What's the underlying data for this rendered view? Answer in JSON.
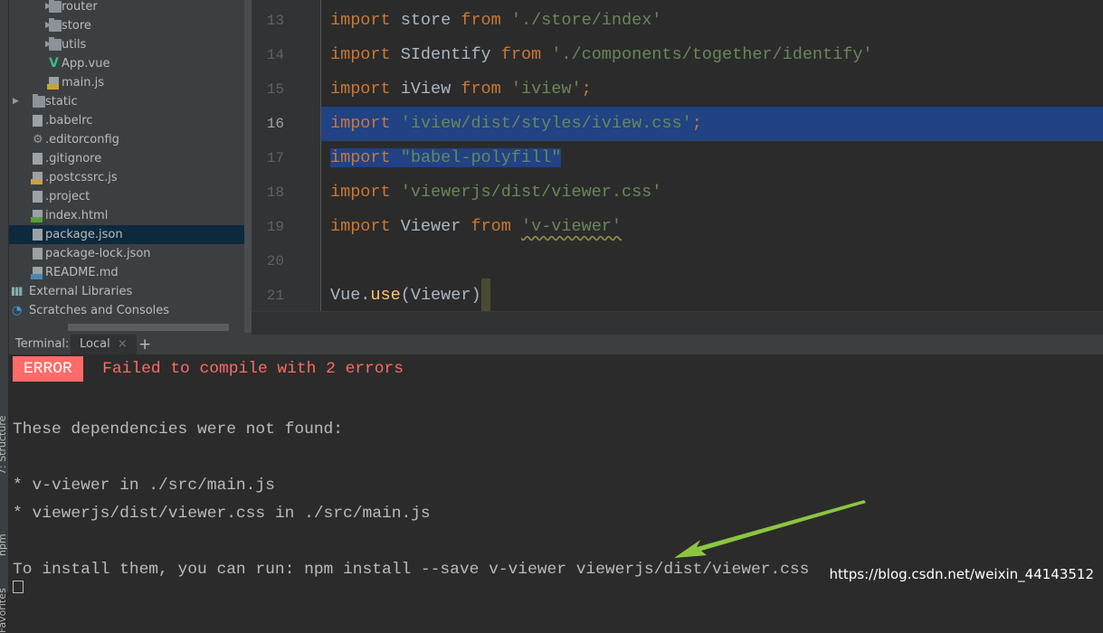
{
  "side_labels": [
    "7: Structure",
    "npm",
    "Favorites"
  ],
  "tree": [
    {
      "label": "router",
      "type": "folder",
      "depth": 2,
      "expandable": true
    },
    {
      "label": "store",
      "type": "folder",
      "depth": 2,
      "expandable": true
    },
    {
      "label": "utils",
      "type": "folder",
      "depth": 2,
      "expandable": true
    },
    {
      "label": "App.vue",
      "type": "vue",
      "depth": 2
    },
    {
      "label": "main.js",
      "type": "js",
      "depth": 2
    },
    {
      "label": "static",
      "type": "folder",
      "depth": 1,
      "expandable": true
    },
    {
      "label": ".babelrc",
      "type": "json",
      "depth": 1
    },
    {
      "label": ".editorconfig",
      "type": "gear",
      "depth": 1
    },
    {
      "label": ".gitignore",
      "type": "text",
      "depth": 1
    },
    {
      "label": ".postcssrc.js",
      "type": "js",
      "depth": 1
    },
    {
      "label": ".project",
      "type": "text",
      "depth": 1
    },
    {
      "label": "index.html",
      "type": "html",
      "depth": 1
    },
    {
      "label": "package.json",
      "type": "json",
      "depth": 1,
      "selected": true
    },
    {
      "label": "package-lock.json",
      "type": "json",
      "depth": 1
    },
    {
      "label": "README.md",
      "type": "md",
      "depth": 1
    },
    {
      "label": "External Libraries",
      "type": "libs",
      "depth": 0
    },
    {
      "label": "Scratches and Consoles",
      "type": "scratch",
      "depth": 0
    }
  ],
  "editor": {
    "current_line": 16,
    "lines": [
      {
        "n": "13",
        "tokens": [
          [
            "import",
            "kw"
          ],
          [
            " store ",
            ""
          ],
          [
            "from",
            "kw"
          ],
          [
            " ",
            ""
          ],
          [
            "'./store/index'",
            "str"
          ]
        ]
      },
      {
        "n": "14",
        "tokens": [
          [
            "import",
            "kw"
          ],
          [
            " SIdentify ",
            ""
          ],
          [
            "from",
            "kw"
          ],
          [
            " ",
            ""
          ],
          [
            "'./components/together/identify'",
            "str"
          ]
        ]
      },
      {
        "n": "15",
        "tokens": [
          [
            "import",
            "kw"
          ],
          [
            " iView ",
            ""
          ],
          [
            "from",
            "kw"
          ],
          [
            " ",
            ""
          ],
          [
            "'iview'",
            "str"
          ],
          [
            ";",
            "kw"
          ]
        ]
      },
      {
        "n": "16",
        "selected": "full",
        "tokens": [
          [
            "import",
            "kw"
          ],
          [
            " ",
            ""
          ],
          [
            "'iview/dist/styles/iview.css'",
            "str"
          ],
          [
            ";",
            "kw"
          ]
        ]
      },
      {
        "n": "17",
        "selected": "text",
        "tokens": [
          [
            "import",
            "kw"
          ],
          [
            " ",
            ""
          ],
          [
            "\"babel-polyfill\"",
            "str"
          ]
        ]
      },
      {
        "n": "18",
        "tokens": [
          [
            "import",
            "kw"
          ],
          [
            " ",
            ""
          ],
          [
            "'viewerjs/dist/viewer.css'",
            "str"
          ]
        ]
      },
      {
        "n": "19",
        "tokens": [
          [
            "import",
            "kw"
          ],
          [
            " Viewer ",
            ""
          ],
          [
            "from",
            "kw"
          ],
          [
            " ",
            ""
          ],
          [
            "'v-viewer'",
            "str wavy"
          ]
        ]
      },
      {
        "n": "20",
        "tokens": []
      },
      {
        "n": "21",
        "caret": true,
        "tokens": [
          [
            "Vue.",
            ""
          ],
          [
            "use",
            "fn"
          ],
          [
            "(Viewer)",
            ""
          ]
        ]
      }
    ]
  },
  "terminal": {
    "label": "Terminal:",
    "tab": "Local",
    "close": "×",
    "add": "+",
    "error_badge": "ERROR",
    "error_msg": "Failed to compile with 2 errors",
    "lines": [
      "These dependencies were not found:",
      "* v-viewer in ./src/main.js",
      "* viewerjs/dist/viewer.css in ./src/main.js",
      "To install them, you can run: npm install --save v-viewer viewerjs/dist/viewer.css"
    ]
  },
  "watermark": "https://blog.csdn.net/weixin_44143512",
  "colors": {
    "keyword": "#cc7832",
    "string": "#6a8759",
    "selection": "#214283",
    "error": "#ff6b68",
    "arrow": "#8cc63f"
  }
}
